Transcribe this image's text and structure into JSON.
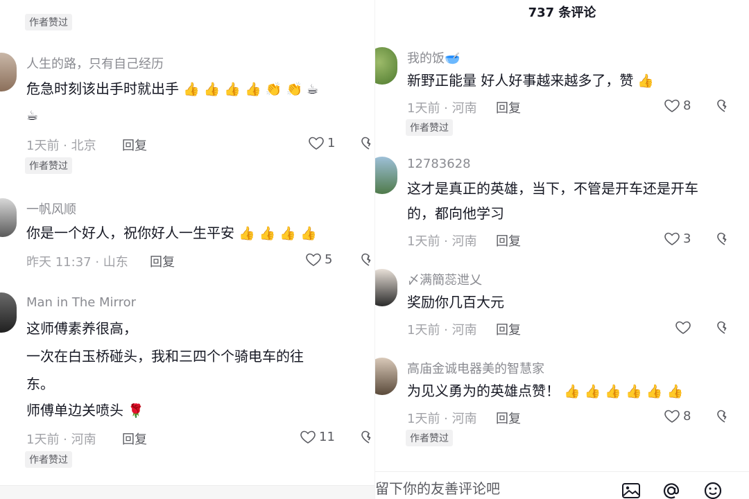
{
  "left": {
    "top_badge": "作者赞过",
    "comments": [
      {
        "username": "人生的路，只有自己经历",
        "line1": "危急时刻该出手时就出手",
        "line1_emoji": "👍 👍 👍 👍 👏 👏 ☕",
        "line2_emoji": "☕",
        "meta": "1天前 · 北京",
        "reply": "回复",
        "likes": "1",
        "badge": "作者赞过"
      },
      {
        "username": "一帆风顺",
        "line1": "你是一个好人，祝你好人一生平安",
        "line1_emoji": "👍 👍 👍 👍",
        "meta": "昨天 11:37 · 山东",
        "reply": "回复",
        "likes": "5"
      },
      {
        "username": "Man in The Mirror",
        "line1": "这师傅素养很高，",
        "line2": "一次在白玉桥碰头，我和三四个个骑电车的往",
        "line3": "东。",
        "line4": "师傅单边关喷头",
        "line4_emoji": "🌹",
        "meta": "1天前 · 河南",
        "reply": "回复",
        "likes": "11",
        "badge": "作者赞过"
      }
    ]
  },
  "right": {
    "comment_count": "737 条评论",
    "comments": [
      {
        "username": "我的饭",
        "username_emoji": "🥣",
        "line1": "新野正能量 好人好事越来越多了，赞",
        "line1_emoji": "👍",
        "meta": "1天前 · 河南",
        "reply": "回复",
        "likes": "8",
        "badge": "作者赞过"
      },
      {
        "username": "12783628",
        "line1": "这才是真正的英雄，当下，不管是开车还是开车",
        "line2": "的，都向他学习",
        "meta": "1天前 · 河南",
        "reply": "回复",
        "likes": "3"
      },
      {
        "username": "〆满簡蕊迣乂",
        "line1": "奖励你几百大元",
        "meta": "1天前 · 河南",
        "reply": "回复",
        "likes": ""
      },
      {
        "username": "高庙金诚电器美的智慧家",
        "line1": "为见义勇为的英雄点赞！",
        "line1_emoji": "👍 👍 👍 👍 👍 👍",
        "meta": "1天前 · 河南",
        "reply": "回复",
        "likes": "8",
        "badge": "作者赞过"
      }
    ],
    "input": {
      "placeholder": "留下你的友善评论吧"
    }
  },
  "icons": {
    "like": "heart-outline-icon",
    "dislike": "broken-heart-icon",
    "image": "image-icon",
    "mention": "at-icon",
    "emoji": "smiley-icon"
  }
}
